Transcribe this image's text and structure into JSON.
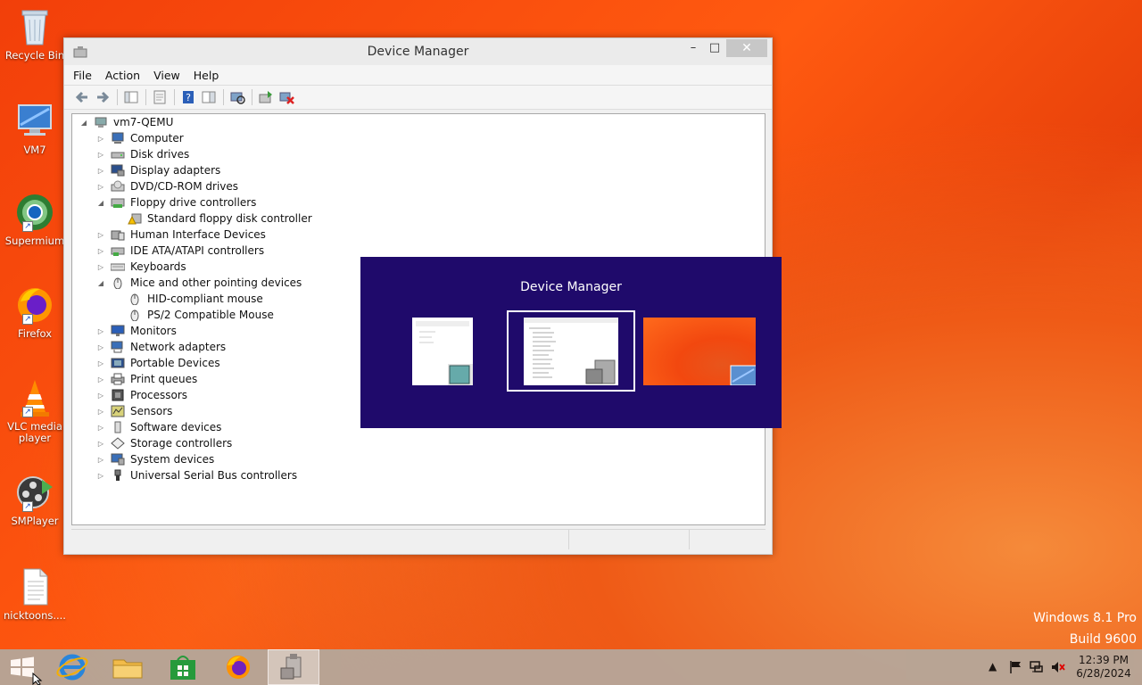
{
  "desktop_icons": [
    {
      "label": "Recycle Bin",
      "icon": "recycle-bin-icon"
    },
    {
      "label": "VM7",
      "icon": "computer-icon"
    },
    {
      "label": "Supermium",
      "icon": "supermium-icon"
    },
    {
      "label": "Firefox",
      "icon": "firefox-icon"
    },
    {
      "label": "VLC media player",
      "icon": "vlc-icon"
    },
    {
      "label": "SMPlayer",
      "icon": "smplayer-icon"
    },
    {
      "label": "nicktoons....",
      "icon": "text-file-icon"
    }
  ],
  "window": {
    "title": "Device Manager",
    "minimize": "–",
    "maximize": "□",
    "close": "✕",
    "menu": [
      "File",
      "Action",
      "View",
      "Help"
    ]
  },
  "tree": {
    "root": "vm7-QEMU",
    "items": [
      {
        "label": "Computer",
        "expanded": false,
        "children": []
      },
      {
        "label": "Disk drives",
        "expanded": false,
        "children": []
      },
      {
        "label": "Display adapters",
        "expanded": false,
        "children": []
      },
      {
        "label": "DVD/CD-ROM drives",
        "expanded": false,
        "children": []
      },
      {
        "label": "Floppy drive controllers",
        "expanded": true,
        "children": [
          "Standard floppy disk controller"
        ]
      },
      {
        "label": "Human Interface Devices",
        "expanded": false,
        "children": []
      },
      {
        "label": "IDE ATA/ATAPI controllers",
        "expanded": false,
        "children": []
      },
      {
        "label": "Keyboards",
        "expanded": false,
        "children": []
      },
      {
        "label": "Mice and other pointing devices",
        "expanded": true,
        "children": [
          "HID-compliant mouse",
          "PS/2 Compatible Mouse"
        ]
      },
      {
        "label": "Monitors",
        "expanded": false,
        "children": []
      },
      {
        "label": "Network adapters",
        "expanded": false,
        "children": []
      },
      {
        "label": "Portable Devices",
        "expanded": false,
        "children": []
      },
      {
        "label": "Print queues",
        "expanded": false,
        "children": []
      },
      {
        "label": "Processors",
        "expanded": false,
        "children": []
      },
      {
        "label": "Sensors",
        "expanded": false,
        "children": []
      },
      {
        "label": "Software devices",
        "expanded": false,
        "children": []
      },
      {
        "label": "Storage controllers",
        "expanded": false,
        "children": []
      },
      {
        "label": "System devices",
        "expanded": false,
        "children": []
      },
      {
        "label": "Universal Serial Bus controllers",
        "expanded": false,
        "children": []
      }
    ]
  },
  "switcher": {
    "title": "Device Manager"
  },
  "watermark": {
    "line1": "Windows 8.1 Pro",
    "line2": "Build 9600"
  },
  "taskbar": {
    "pinned": [
      "start-icon",
      "internet-explorer-icon",
      "file-explorer-icon",
      "store-icon",
      "firefox-icon",
      "device-manager-icon"
    ],
    "tray_arrow": "▲",
    "time": "12:39 PM",
    "date": "6/28/2024"
  }
}
